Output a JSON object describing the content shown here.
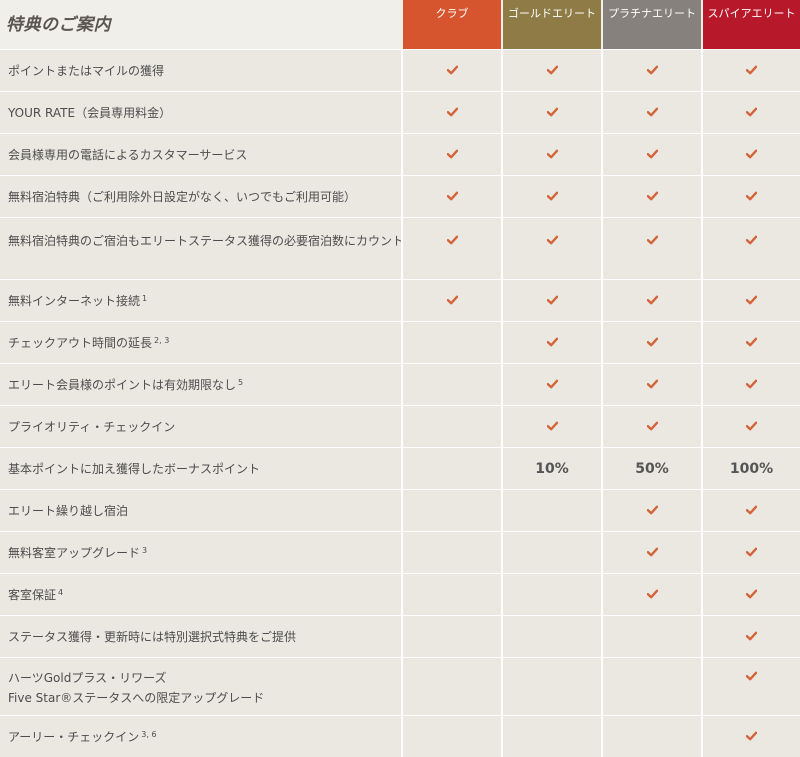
{
  "title": "特典のご案内",
  "tiers": [
    "クラブ",
    "ゴールドエリート",
    "プラチナエリート",
    "スパイアエリート"
  ],
  "accent_colors": {
    "club": "#d6552e",
    "gold": "#8e7b45",
    "platinum": "#86817c",
    "spire": "#b8192a",
    "check": "#d4643a"
  },
  "rows": [
    {
      "label": "ポイントまたはマイルの獲得",
      "sup": "",
      "values": [
        "check",
        "check",
        "check",
        "check"
      ]
    },
    {
      "label": "YOUR RATE（会員専用料金）",
      "sup": "",
      "values": [
        "check",
        "check",
        "check",
        "check"
      ]
    },
    {
      "label": "会員様専用の電話によるカスタマーサービス",
      "sup": "",
      "values": [
        "check",
        "check",
        "check",
        "check"
      ]
    },
    {
      "label": "無料宿泊特典（ご利用除外日設定がなく、いつでもご利用可能）",
      "sup": "",
      "values": [
        "check",
        "check",
        "check",
        "check"
      ]
    },
    {
      "label": "無料宿泊特典のご宿泊もエリートステータス獲得の必要宿泊数にカウント",
      "sup": "",
      "values": [
        "check",
        "check",
        "check",
        "check"
      ]
    },
    {
      "label": "無料インターネット接続",
      "sup": "1",
      "values": [
        "check",
        "check",
        "check",
        "check"
      ]
    },
    {
      "label": "チェックアウト時間の延長",
      "sup": "2, 3",
      "values": [
        "",
        "check",
        "check",
        "check"
      ]
    },
    {
      "label": "エリート会員様のポイントは有効期限なし",
      "sup": "5",
      "values": [
        "",
        "check",
        "check",
        "check"
      ]
    },
    {
      "label": "プライオリティ・チェックイン",
      "sup": "",
      "values": [
        "",
        "check",
        "check",
        "check"
      ]
    },
    {
      "label": "基本ポイントに加え獲得したボーナスポイント",
      "sup": "",
      "values": [
        "",
        "10%",
        "50%",
        "100%"
      ]
    },
    {
      "label": "エリート繰り越し宿泊",
      "sup": "",
      "values": [
        "",
        "",
        "check",
        "check"
      ]
    },
    {
      "label": "無料客室アップグレード",
      "sup": "3",
      "values": [
        "",
        "",
        "check",
        "check"
      ]
    },
    {
      "label": "客室保証",
      "sup": "4",
      "values": [
        "",
        "",
        "check",
        "check"
      ]
    },
    {
      "label": "ステータス獲得・更新時には特別選択式特典をご提供",
      "sup": "",
      "values": [
        "",
        "",
        "",
        "check"
      ]
    },
    {
      "label": "ハーツGoldプラス・リワーズ",
      "label2": "Five Star®ステータスへの限定アップグレード",
      "sup": "",
      "values": [
        "",
        "",
        "",
        "check"
      ]
    },
    {
      "label": "アーリー・チェックイン",
      "sup": "3, 6",
      "values": [
        "",
        "",
        "",
        "check"
      ]
    }
  ]
}
